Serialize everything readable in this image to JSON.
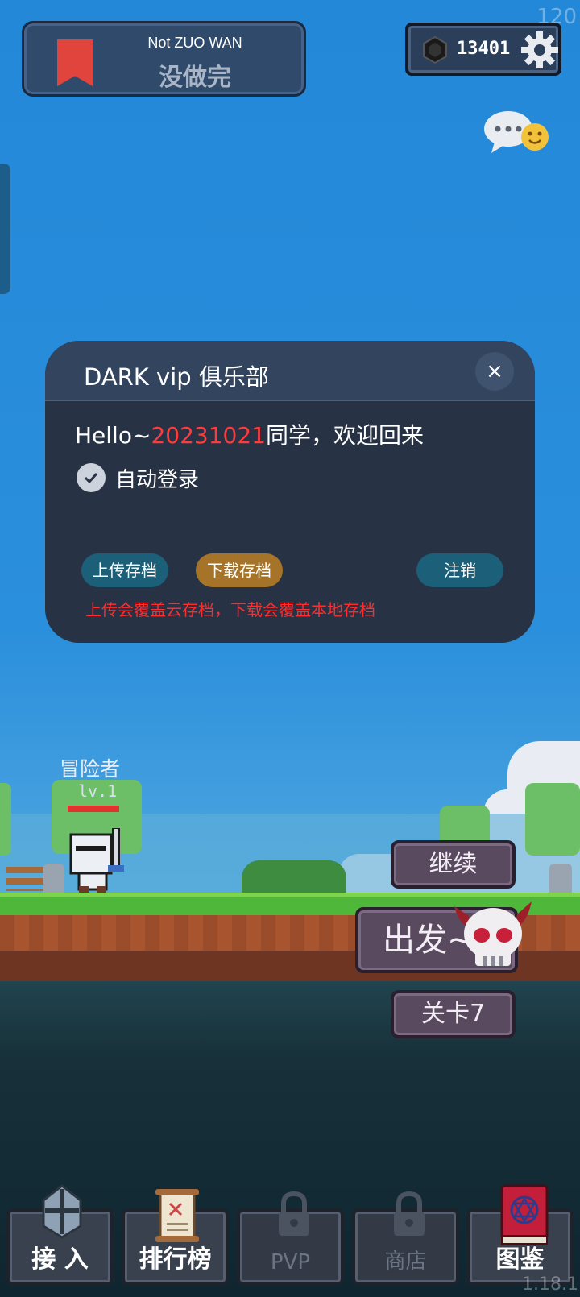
{
  "status": {
    "fps": "120",
    "version": "1.18.1"
  },
  "banner": {
    "subtitle": "Not ZUO WAN",
    "title": "没做完",
    "icon": "bookmark-icon"
  },
  "currency": {
    "value": "13401",
    "icon": "gem-icon"
  },
  "dialog": {
    "title": "DARK vip 俱乐部",
    "close_label": "×",
    "greeting_prefix": "Hello~",
    "greeting_id": "20231021",
    "greeting_suffix": "同学，欢迎回来",
    "auto_login_label": "自动登录",
    "auto_login_checked": true,
    "upload_label": "上传存档",
    "download_label": "下载存档",
    "logout_label": "注销",
    "warning": "上传会覆盖云存档，下载会覆盖本地存档"
  },
  "hero": {
    "name": "冒险者",
    "level": "lv.1",
    "hp_fraction": 1.0
  },
  "actions": {
    "continue_label": "继续",
    "depart_label": "出发~",
    "stage_label": "关卡7"
  },
  "nav": [
    {
      "label": "接 入",
      "icon": "knight-helmet-icon",
      "locked": false
    },
    {
      "label": "排行榜",
      "icon": "scroll-icon",
      "locked": false
    },
    {
      "label": "PVP",
      "icon": "lock-icon",
      "locked": true
    },
    {
      "label": "商店",
      "icon": "lock-icon",
      "locked": true
    },
    {
      "label": "图鉴",
      "icon": "spellbook-icon",
      "locked": false
    }
  ],
  "colors": {
    "sky": "#2388d8",
    "dialog_bg": "#273244",
    "highlight": "#ff3b3b",
    "grass": "#4fb83a"
  }
}
